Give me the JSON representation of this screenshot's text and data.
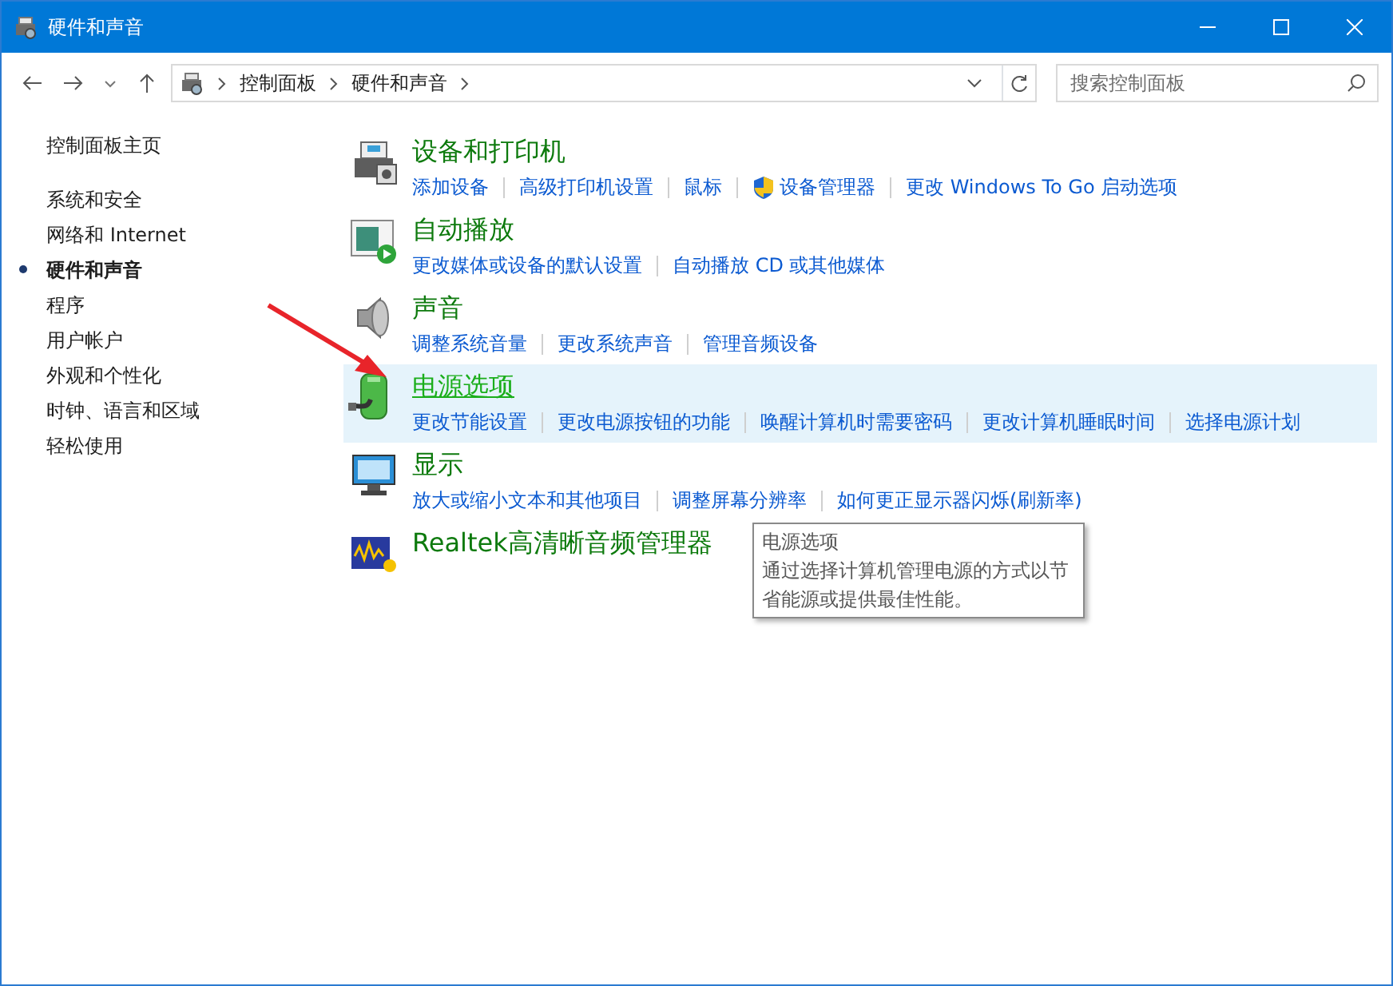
{
  "window": {
    "title": "硬件和声音"
  },
  "address_bar": {
    "crumbs": [
      "控制面板",
      "硬件和声音"
    ]
  },
  "search": {
    "placeholder": "搜索控制面板"
  },
  "sidebar": {
    "home": "控制面板主页",
    "items": [
      {
        "label": "系统和安全",
        "selected": false
      },
      {
        "label": "网络和 Internet",
        "selected": false
      },
      {
        "label": "硬件和声音",
        "selected": true
      },
      {
        "label": "程序",
        "selected": false
      },
      {
        "label": "用户帐户",
        "selected": false
      },
      {
        "label": "外观和个性化",
        "selected": false
      },
      {
        "label": "时钟、语言和区域",
        "selected": false
      },
      {
        "label": "轻松使用",
        "selected": false
      }
    ]
  },
  "categories": [
    {
      "title": "设备和打印机",
      "highlighted": false,
      "links": [
        {
          "label": "添加设备",
          "shield": false
        },
        {
          "label": "高级打印机设置",
          "shield": false
        },
        {
          "label": "鼠标",
          "shield": false
        },
        {
          "label": "设备管理器",
          "shield": true
        },
        {
          "label": "更改 Windows To Go 启动选项",
          "shield": false
        }
      ]
    },
    {
      "title": "自动播放",
      "highlighted": false,
      "links": [
        {
          "label": "更改媒体或设备的默认设置",
          "shield": false
        },
        {
          "label": "自动播放 CD 或其他媒体",
          "shield": false
        }
      ]
    },
    {
      "title": "声音",
      "highlighted": false,
      "links": [
        {
          "label": "调整系统音量",
          "shield": false
        },
        {
          "label": "更改系统声音",
          "shield": false
        },
        {
          "label": "管理音频设备",
          "shield": false
        }
      ]
    },
    {
      "title": "电源选项",
      "highlighted": true,
      "links": [
        {
          "label": "更改节能设置",
          "shield": false
        },
        {
          "label": "更改电源按钮的功能",
          "shield": false
        },
        {
          "label": "唤醒计算机时需要密码",
          "shield": false
        },
        {
          "label": "更改计算机睡眠时间",
          "shield": false
        },
        {
          "label": "选择电源计划",
          "shield": false
        }
      ]
    },
    {
      "title": "显示",
      "highlighted": false,
      "links": [
        {
          "label": "放大或缩小文本和其他项目",
          "shield": false
        },
        {
          "label": "调整屏幕分辨率",
          "shield": false
        },
        {
          "label": "如何更正显示器闪烁(刷新率)",
          "shield": false
        }
      ]
    },
    {
      "title": "Realtek高清晰音频管理器",
      "highlighted": false
    }
  ],
  "tooltip": {
    "title": "电源选项",
    "text": "通过选择计算机管理电源的方式以节省能源或提供最佳性能。"
  }
}
